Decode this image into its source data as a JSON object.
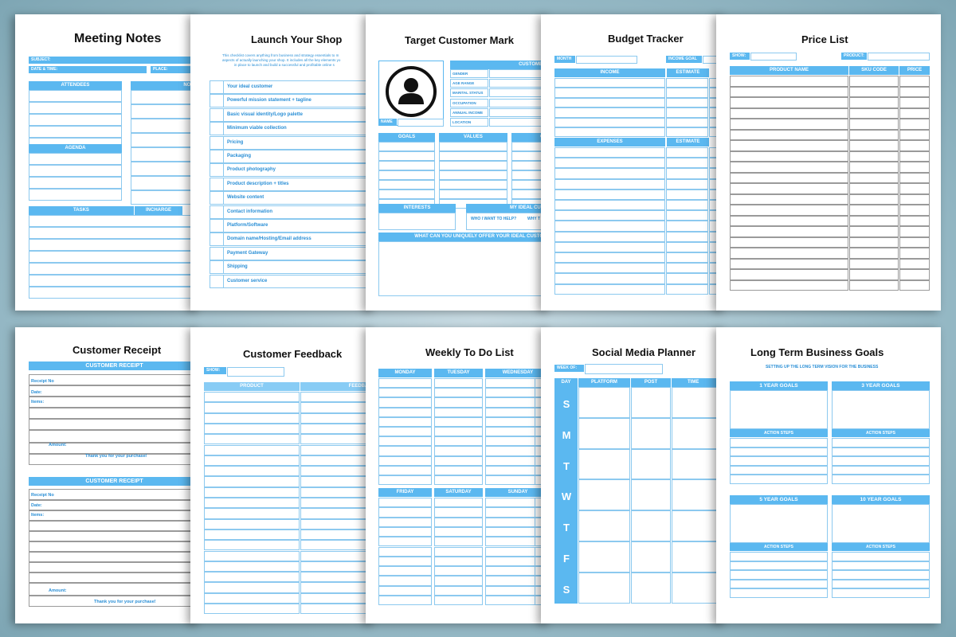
{
  "meeting_notes": {
    "title": "Meeting  Notes",
    "subject": "SUBJECT:",
    "date_time": "DATE & TIME:",
    "place": "PLACE:",
    "attendees": "ATTENDEES",
    "notes": "NOTES",
    "agenda": "AGENDA",
    "tasks": "TASKS",
    "incharge": "INCHARGE"
  },
  "launch_shop": {
    "title": "Launch Your Shop",
    "intro_1": "This checklist covers anything from business and strategy essentials to m",
    "intro_2": "aspects of actually launching your shop. It includes all the key elements yo",
    "intro_3": "in place to launch and build a successful and profitable online s",
    "items": [
      "Your ideal customer",
      "Powerful mission statement + tagline",
      "Basic visual identity/Logo palette",
      "Minimum viable collection",
      "Pricing",
      "Packaging",
      "Product photography",
      "Product description + titles",
      "Website content",
      "Contact information",
      "Platform/Software",
      "Domain name/Hosting/Email address",
      "Payment Gateway",
      "Shipping",
      "Customer service"
    ]
  },
  "target_customer": {
    "title": "Target Customer Mark",
    "customer_p": "CUSTOMER P",
    "name": "NAME",
    "fields": [
      "GENDER",
      "AGE RANGE",
      "MARITAL STATUS",
      "OCCUPATION",
      "ANNUAL INCOME",
      "LOCATION"
    ],
    "goals": "GOALS",
    "values": "VALUES",
    "cha": "CHA",
    "interests": "INTERESTS",
    "my_ideal": "MY IDEAL CUSTO",
    "who_help": "WHO I WANT TO HELP?",
    "why_t": "WHY T",
    "offer": "WHAT CAN YOU UNIQUELY OFFER YOUR IDEAL CUSTOME"
  },
  "budget": {
    "title": "Budget Tracker",
    "month": "MONTH",
    "income_goal": "INCOME GOAL",
    "income": "INCOME",
    "estimate": "ESTIMATE",
    "expenses": "EXPENSES"
  },
  "price_list": {
    "title": "Price List",
    "show": "SHOW:",
    "product": "Product:",
    "product_name": "PRODUCT NAME",
    "sku": "SKU CODE",
    "price": "PRICE"
  },
  "receipt": {
    "title": "Customer  Receipt",
    "header": "CUSTOMER RECEIPT",
    "receipt_no": "Receipt No",
    "date": "Date:",
    "items": "Items:",
    "amount": "Amount:",
    "thanks": "Thank you for your purchase!"
  },
  "feedback": {
    "title": "Customer Feedback",
    "show": "SHOW:",
    "product": "PRODUCT",
    "feedback": "FEEDBACK"
  },
  "weekly": {
    "title": "Weekly To Do List",
    "days_top": [
      "MONDAY",
      "TUESDAY",
      "WEDNESDAY"
    ],
    "days_bottom": [
      "FRIDAY",
      "SATURDAY",
      "SUNDAY"
    ]
  },
  "social": {
    "title": "Social Media Planner",
    "week_of": "WEEK OF:",
    "day": "DAY",
    "platform": "PLATFORM",
    "post": "POST",
    "time": "TIME",
    "letters": [
      "S",
      "M",
      "T",
      "W",
      "T",
      "F",
      "S"
    ]
  },
  "goals": {
    "title": "Long Term Business Goals",
    "subtitle": "SETTING UP THE LONG TERM VISION FOR THE BUSINESS",
    "y1": "1 YEAR GOALS",
    "y3": "3 YEAR GOALS",
    "y5": "5 YEAR GOALS",
    "y10": "10 YEAR GOALS",
    "action": "ACTION STEPS"
  },
  "colors": {
    "accent": "#5bb8f0",
    "border": "#8cc9ef"
  }
}
